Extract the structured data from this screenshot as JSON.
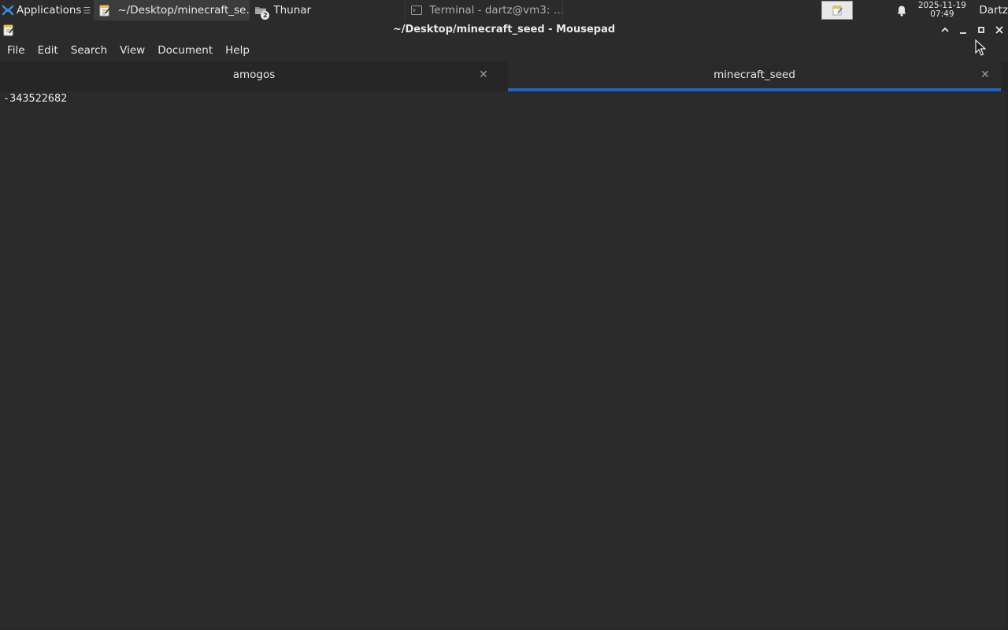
{
  "panel": {
    "applications_label": "Applications",
    "tasks": [
      {
        "label": "~/Desktop/minecraft_se…",
        "icon": "mousepad-icon"
      },
      {
        "label": "Thunar",
        "icon": "folder-icon",
        "badge": "2"
      },
      {
        "label": "Terminal - dartz@vm3: …",
        "icon": "terminal-icon"
      }
    ],
    "clock_date": "2025-11-19",
    "clock_time": "07:49",
    "user": "Dartz"
  },
  "window": {
    "title": "~/Desktop/minecraft_seed - Mousepad"
  },
  "menubar": {
    "items": [
      "File",
      "Edit",
      "Search",
      "View",
      "Document",
      "Help"
    ]
  },
  "tabs": [
    {
      "label": "amogos",
      "active": false
    },
    {
      "label": "minecraft_seed",
      "active": true
    }
  ],
  "editor": {
    "content": "-343522682"
  },
  "colors": {
    "background": "#2a2a2a",
    "panel": "#2b2b2b",
    "active_tab_indicator": "#1c64c8"
  }
}
